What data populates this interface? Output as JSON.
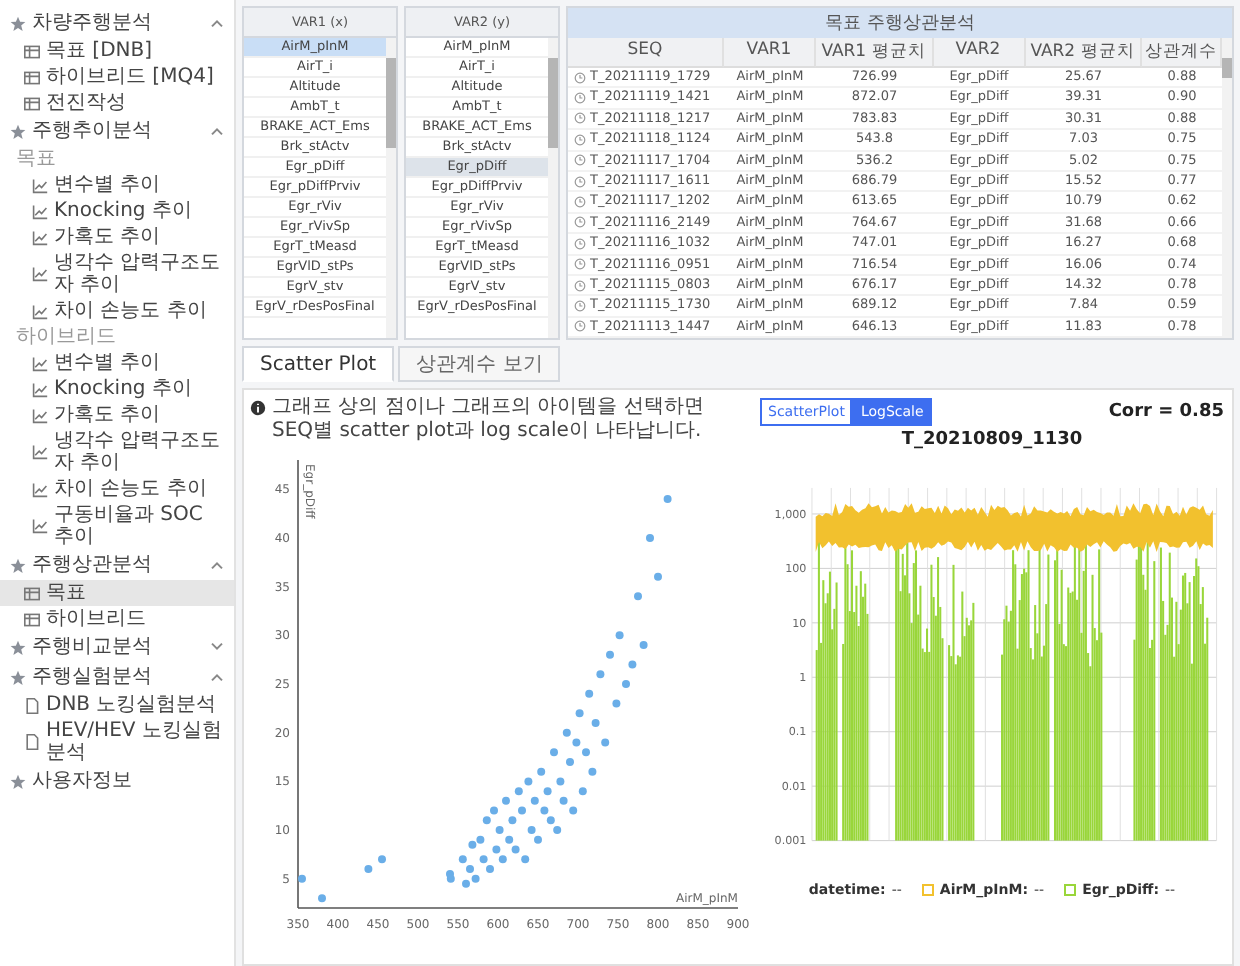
{
  "sidebar": {
    "sections": [
      {
        "title": "차량주행분석",
        "expanded": true,
        "items": [
          {
            "kind": "table",
            "label": "목표 [DNB]",
            "selected": false
          },
          {
            "kind": "table",
            "label": "하이브리드 [MQ4]",
            "selected": false
          },
          {
            "kind": "table",
            "label": "전진작성",
            "selected": false
          }
        ]
      },
      {
        "title": "주행추이분석",
        "expanded": true,
        "items": [
          {
            "kind": "group",
            "label": "목표"
          },
          {
            "kind": "trend",
            "label": "변수별 추이",
            "selected": false
          },
          {
            "kind": "trend",
            "label": "Knocking 추이",
            "selected": false
          },
          {
            "kind": "trend",
            "label": "가혹도 추이",
            "selected": false
          },
          {
            "kind": "trend",
            "label": "냉각수 압력구조도자 추이",
            "selected": false
          },
          {
            "kind": "trend",
            "label": "차이 손능도 추이",
            "selected": false
          },
          {
            "kind": "group",
            "label": "하이브리드"
          },
          {
            "kind": "trend",
            "label": "변수별 추이",
            "selected": false
          },
          {
            "kind": "trend",
            "label": "Knocking 추이",
            "selected": false
          },
          {
            "kind": "trend",
            "label": "가혹도 추이",
            "selected": false
          },
          {
            "kind": "trend",
            "label": "냉각수 압력구조도자 추이",
            "selected": false
          },
          {
            "kind": "trend",
            "label": "차이 손능도 추이",
            "selected": false
          },
          {
            "kind": "trend",
            "label": "구동비율과 SOC 추이",
            "selected": false
          }
        ]
      },
      {
        "title": "주행상관분석",
        "expanded": true,
        "items": [
          {
            "kind": "table",
            "label": "목표",
            "selected": true
          },
          {
            "kind": "table",
            "label": "하이브리드",
            "selected": false
          }
        ]
      },
      {
        "title": "주행비교분석",
        "expanded": false
      },
      {
        "title": "주행실험분석",
        "expanded": true,
        "items": [
          {
            "kind": "doc",
            "label": "DNB 노킹실험분석",
            "selected": false
          },
          {
            "kind": "doc",
            "label": "HEV/HEV 노킹실험분석",
            "selected": false
          }
        ]
      },
      {
        "title": "사용자정보"
      }
    ]
  },
  "var_lists": [
    {
      "header": "VAR1 (x)",
      "items": [
        {
          "label": "AirM_pInM",
          "selected": true
        },
        {
          "label": "AirT_i",
          "selected": false
        },
        {
          "label": "Altitude",
          "selected": false
        },
        {
          "label": "AmbT_t",
          "selected": false
        },
        {
          "label": "BRAKE_ACT_Ems",
          "selected": false
        },
        {
          "label": "Brk_stActv",
          "selected": false
        },
        {
          "label": "Egr_pDiff",
          "selected": false
        },
        {
          "label": "Egr_pDiffPrviv",
          "selected": false
        },
        {
          "label": "Egr_rViv",
          "selected": false
        },
        {
          "label": "Egr_rVivSp",
          "selected": false
        },
        {
          "label": "EgrT_tMeasd",
          "selected": false
        },
        {
          "label": "EgrVlD_stPs",
          "selected": false
        },
        {
          "label": "EgrV_stv",
          "selected": false
        },
        {
          "label": "EgrV_rDesPosFinal",
          "selected": false
        }
      ]
    },
    {
      "header": "VAR2 (y)",
      "items": [
        {
          "label": "AirM_pInM",
          "selected": false
        },
        {
          "label": "AirT_i",
          "selected": false
        },
        {
          "label": "Altitude",
          "selected": false
        },
        {
          "label": "AmbT_t",
          "selected": false
        },
        {
          "label": "BRAKE_ACT_Ems",
          "selected": false
        },
        {
          "label": "Brk_stActv",
          "selected": false
        },
        {
          "label": "Egr_pDiff",
          "selected": true
        },
        {
          "label": "Egr_pDiffPrviv",
          "selected": false
        },
        {
          "label": "Egr_rViv",
          "selected": false
        },
        {
          "label": "Egr_rVivSp",
          "selected": false
        },
        {
          "label": "EgrT_tMeasd",
          "selected": false
        },
        {
          "label": "EgrVlD_stPs",
          "selected": false
        },
        {
          "label": "EgrV_stv",
          "selected": false
        },
        {
          "label": "EgrV_rDesPosFinal",
          "selected": false
        }
      ]
    }
  ],
  "table": {
    "title": "목표 주행상관분석",
    "columns": [
      "SEQ",
      "VAR1",
      "VAR1 평균치",
      "VAR2",
      "VAR2 평균치",
      "상관계수"
    ],
    "rows": [
      [
        "T_20211119_1729",
        "AirM_pInM",
        "726.99",
        "Egr_pDiff",
        "25.67",
        "0.88"
      ],
      [
        "T_20211119_1421",
        "AirM_pInM",
        "872.07",
        "Egr_pDiff",
        "39.31",
        "0.90"
      ],
      [
        "T_20211118_1217",
        "AirM_pInM",
        "783.83",
        "Egr_pDiff",
        "30.31",
        "0.88"
      ],
      [
        "T_20211118_1124",
        "AirM_pInM",
        "543.8",
        "Egr_pDiff",
        "7.03",
        "0.75"
      ],
      [
        "T_20211117_1704",
        "AirM_pInM",
        "536.2",
        "Egr_pDiff",
        "5.02",
        "0.75"
      ],
      [
        "T_20211117_1611",
        "AirM_pInM",
        "686.79",
        "Egr_pDiff",
        "15.52",
        "0.77"
      ],
      [
        "T_20211117_1202",
        "AirM_pInM",
        "613.65",
        "Egr_pDiff",
        "10.79",
        "0.62"
      ],
      [
        "T_20211116_2149",
        "AirM_pInM",
        "764.67",
        "Egr_pDiff",
        "31.68",
        "0.66"
      ],
      [
        "T_20211116_1032",
        "AirM_pInM",
        "747.01",
        "Egr_pDiff",
        "16.27",
        "0.68"
      ],
      [
        "T_20211116_0951",
        "AirM_pInM",
        "716.54",
        "Egr_pDiff",
        "16.06",
        "0.74"
      ],
      [
        "T_20211115_0803",
        "AirM_pInM",
        "676.17",
        "Egr_pDiff",
        "14.32",
        "0.78"
      ],
      [
        "T_20211115_1730",
        "AirM_pInM",
        "689.12",
        "Egr_pDiff",
        "7.84",
        "0.59"
      ],
      [
        "T_20211113_1447",
        "AirM_pInM",
        "646.13",
        "Egr_pDiff",
        "11.83",
        "0.78"
      ]
    ]
  },
  "tabs": [
    {
      "label": "Scatter Plot",
      "selected": true
    },
    {
      "label": "상관계수 보기",
      "selected": false
    }
  ],
  "scatter": {
    "info": "그래프 상의 점이나 그래프의 아이템을 선택하면 SEQ별 scatter plot과 log scale이 나타납니다.",
    "chart_data": {
      "type": "scatter",
      "xlabel": "AirM_pInM",
      "xlim": [
        350,
        900
      ],
      "ylim": [
        2,
        48
      ],
      "xticks": [
        350,
        400,
        450,
        500,
        550,
        600,
        650,
        700,
        750,
        800,
        850,
        900
      ],
      "yticks": [
        5,
        10,
        15,
        20,
        25,
        30,
        35,
        40,
        45
      ],
      "x": [
        355,
        380,
        438,
        455,
        540,
        541,
        556,
        560,
        565,
        568,
        572,
        578,
        582,
        586,
        590,
        595,
        598,
        602,
        606,
        610,
        614,
        618,
        622,
        626,
        630,
        634,
        638,
        642,
        646,
        650,
        654,
        658,
        662,
        666,
        670,
        674,
        678,
        682,
        686,
        690,
        694,
        698,
        702,
        706,
        710,
        714,
        718,
        722,
        728,
        734,
        740,
        748,
        752,
        760,
        768,
        775,
        782,
        790,
        800,
        812
      ],
      "series": [
        {
          "name": "Egr_pDiff",
          "color": "#6aaee8",
          "values": [
            5,
            3,
            6,
            7,
            5.5,
            5,
            7,
            4.5,
            6,
            8.5,
            5,
            9,
            7,
            11,
            6,
            12,
            8,
            10,
            7,
            13,
            9,
            11,
            8,
            14,
            12,
            7,
            15,
            10,
            13,
            9,
            16,
            12,
            14,
            11,
            18,
            10,
            15,
            13,
            20,
            17,
            12,
            19,
            22,
            14,
            18,
            24,
            16,
            21,
            26,
            19,
            28,
            23,
            30,
            25,
            27,
            34,
            29,
            40,
            36,
            44
          ]
        }
      ]
    }
  },
  "log_chart": {
    "toggle": [
      {
        "label": "ScatterPlot",
        "selected": false
      },
      {
        "label": "LogScale",
        "selected": true
      }
    ],
    "corr": "Corr = 0.85",
    "title": "T_20210809_1130",
    "yticks": [
      "1,000",
      "100",
      "10",
      "1",
      "0.1",
      "0.01",
      "0.001"
    ],
    "legend": [
      {
        "label": "datetime:",
        "value": "--"
      },
      {
        "label": "AirM_pInM:",
        "value": "--",
        "color": "#f2c12e"
      },
      {
        "label": "Egr_pDiff:",
        "value": "--",
        "color": "#99d63a"
      }
    ]
  }
}
